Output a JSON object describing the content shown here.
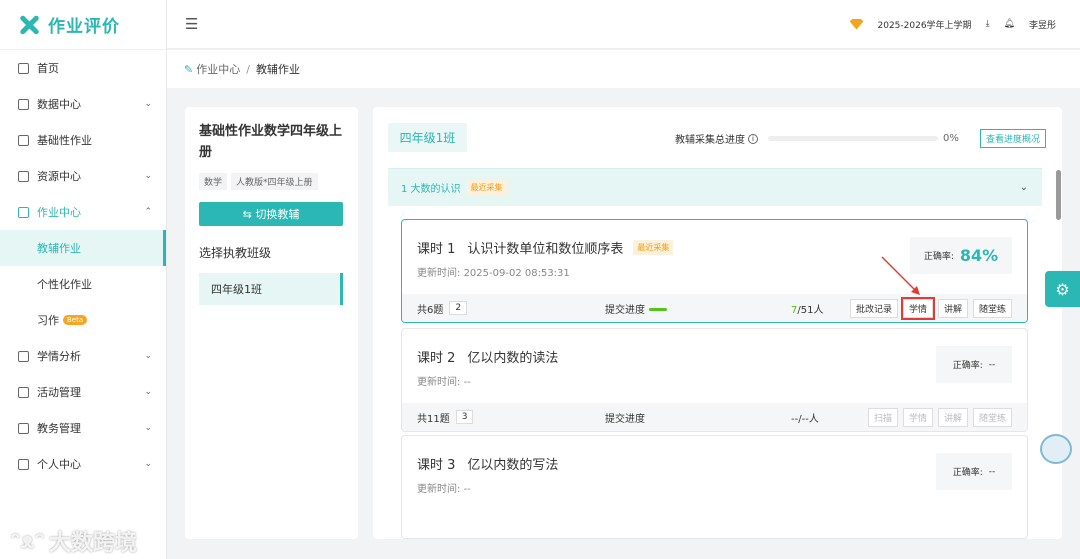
{
  "app": {
    "name": "作业评价"
  },
  "sidebar": {
    "items": [
      {
        "label": "首页",
        "icon": "home-icon"
      },
      {
        "label": "数据中心",
        "icon": "chart-icon",
        "chevron": "⌄"
      },
      {
        "label": "基础性作业",
        "icon": "doc-icon"
      },
      {
        "label": "资源中心",
        "icon": "grid-icon",
        "chevron": "⌄"
      },
      {
        "label": "作业中心",
        "icon": "edit-icon",
        "chevron": "⌃"
      },
      {
        "label": "教辅作业"
      },
      {
        "label": "个性化作业"
      },
      {
        "label": "习作",
        "badge": "Beta"
      },
      {
        "label": "学情分析",
        "icon": "analysis-icon",
        "chevron": "⌄"
      },
      {
        "label": "活动管理",
        "icon": "gift-icon",
        "chevron": "⌄"
      },
      {
        "label": "教务管理",
        "icon": "school-icon",
        "chevron": "⌄"
      },
      {
        "label": "个人中心",
        "icon": "user-icon",
        "chevron": "⌄"
      }
    ]
  },
  "topbar": {
    "term": "2025-2026学年上学期",
    "user": "李昱彤"
  },
  "breadcrumb": {
    "parent": "作业中心",
    "sep": "/",
    "current": "教辅作业"
  },
  "left": {
    "book_title": "基础性作业数学四年级上册",
    "tags": [
      "数学",
      "人教版*四年级上册"
    ],
    "switch_label": "⇆ 切换教辅",
    "select_label": "选择执教班级",
    "class_name": "四年级1班"
  },
  "main": {
    "class_tab": "四年级1班",
    "progress_label": "教辅采集总进度",
    "progress_value": 0,
    "progress_text": "0%",
    "view_btn": "查看进度概况",
    "unit": {
      "title": "1 大数的认识",
      "badge": "最近采集"
    },
    "lessons": [
      {
        "num": "课时 1",
        "title": "认识计数单位和数位顺序表",
        "badge": "最近采集",
        "time_label": "更新时间:",
        "time": "2025-09-02 08:53:31",
        "acc_label": "正确率:",
        "acc": "84%",
        "q_label": "共6题",
        "q_num": "2",
        "submit_label": "提交进度",
        "submit_done": "7",
        "submit_total": "/51人",
        "actions": [
          "批改记录",
          "学情",
          "讲解",
          "随堂练"
        ]
      },
      {
        "num": "课时 2",
        "title": "亿以内数的读法",
        "time_label": "更新时间:",
        "time": "--",
        "acc_label": "正确率:",
        "acc": "--",
        "q_label": "共11题",
        "q_num": "3",
        "submit_label": "提交进度",
        "submit_text": "--/--人",
        "actions": [
          "扫描",
          "学情",
          "讲解",
          "随堂练"
        ]
      },
      {
        "num": "课时 3",
        "title": "亿以内数的写法",
        "time_label": "更新时间:",
        "time": "--",
        "acc_label": "正确率:",
        "acc": "--"
      }
    ]
  },
  "watermark": "大数跨境",
  "colors": {
    "accent": "#2bb7b3",
    "highlight": "#e53935",
    "badge": "#f39c12"
  }
}
